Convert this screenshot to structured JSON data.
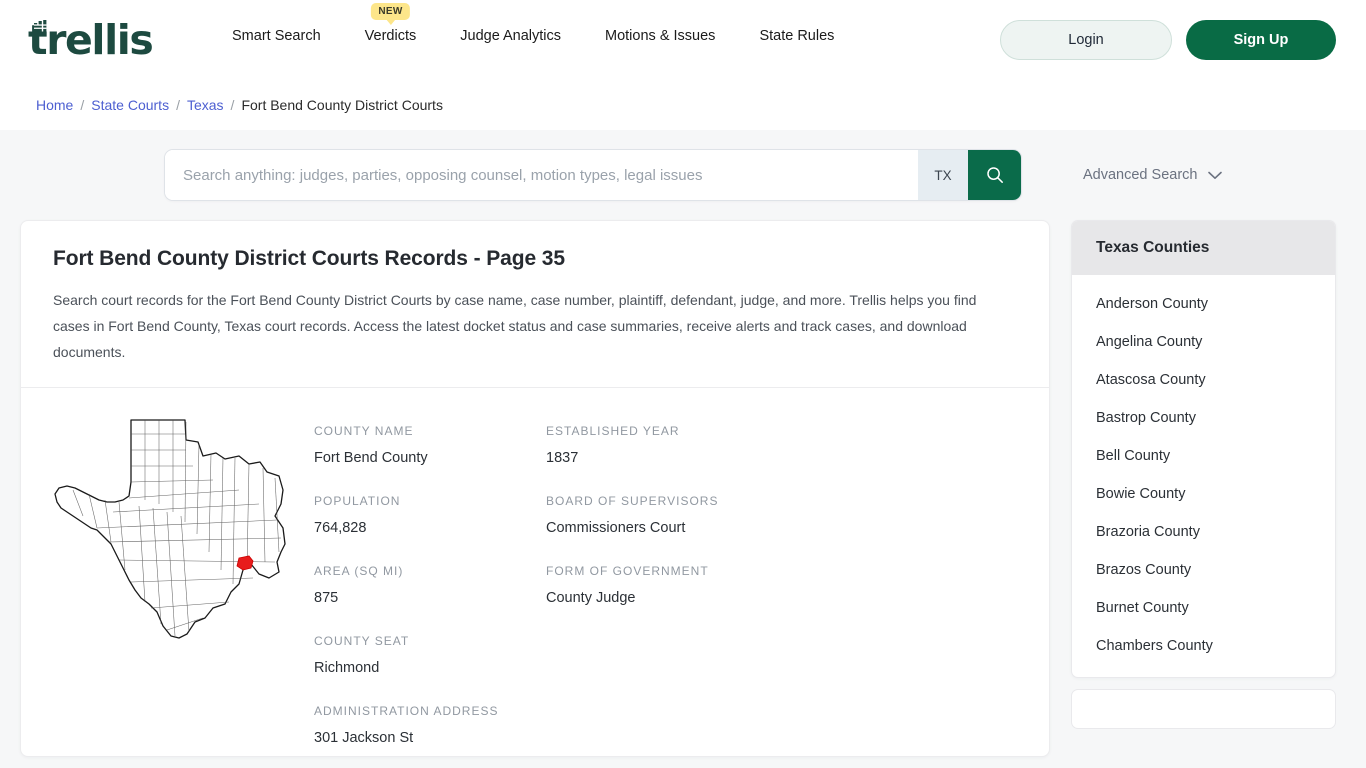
{
  "brand": {
    "logo_text": "trellis",
    "logo_color": "#1d4a40"
  },
  "header": {
    "nav": [
      {
        "label": "Smart Search",
        "badge": null
      },
      {
        "label": "Verdicts",
        "badge": "NEW"
      },
      {
        "label": "Judge Analytics",
        "badge": null
      },
      {
        "label": "Motions & Issues",
        "badge": null
      },
      {
        "label": "State Rules",
        "badge": null
      }
    ],
    "login_label": "Login",
    "signup_label": "Sign Up"
  },
  "breadcrumb": {
    "items": [
      "Home",
      "State Courts",
      "Texas"
    ],
    "separator": "/",
    "current": "Fort Bend County District Courts"
  },
  "search": {
    "placeholder": "Search anything: judges, parties, opposing counsel, motion types, legal issues",
    "value": "",
    "state_chip": "TX",
    "advanced_label": "Advanced Search"
  },
  "main": {
    "title": "Fort Bend County District Courts Records - Page 35",
    "description": "Search court records for the Fort Bend County District Courts by case name, case number, plaintiff, defendant, judge, and more. Trellis helps you find cases in Fort Bend County, Texas court records. Access the latest docket status and case summaries, receive alerts and track cases, and download documents.",
    "map_alt": "Texas county map with Fort Bend County highlighted",
    "fields_left": [
      {
        "label": "COUNTY NAME",
        "value": "Fort Bend County"
      },
      {
        "label": "POPULATION",
        "value": "764,828"
      },
      {
        "label": "AREA (SQ MI)",
        "value": "875"
      },
      {
        "label": "COUNTY SEAT",
        "value": "Richmond"
      },
      {
        "label": "ADMINISTRATION ADDRESS",
        "value": "301 Jackson St"
      }
    ],
    "fields_right": [
      {
        "label": "ESTABLISHED YEAR",
        "value": "1837"
      },
      {
        "label": "BOARD OF SUPERVISORS",
        "value": "Commissioners Court"
      },
      {
        "label": "FORM OF GOVERNMENT",
        "value": "County Judge"
      }
    ]
  },
  "sidebar": {
    "title": "Texas Counties",
    "counties": [
      "Anderson County",
      "Angelina County",
      "Atascosa County",
      "Bastrop County",
      "Bell County",
      "Bowie County",
      "Brazoria County",
      "Brazos County",
      "Burnet County",
      "Chambers County"
    ]
  },
  "colors": {
    "brand_green": "#096b45",
    "accent_link": "#4d5fd1",
    "badge_yellow": "#fde68a",
    "map_highlight": "#e81c1c"
  }
}
